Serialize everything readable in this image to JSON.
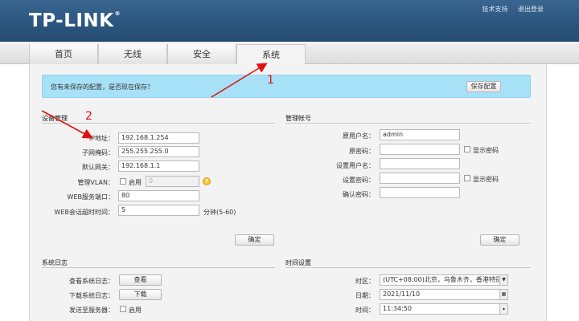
{
  "header": {
    "logo": "TP-LINK",
    "reg": "®",
    "links": [
      "技术支持",
      "退出登录"
    ]
  },
  "tabs": [
    "首页",
    "无线",
    "安全",
    "系统"
  ],
  "active_tab": "系统",
  "notice": {
    "text": "您有未保存的配置，是否现在保存？",
    "save_label": "保存配置"
  },
  "annotations": [
    "1",
    "2"
  ],
  "device_mgmt": {
    "title": "设备管理",
    "ip_label": "IP地址：",
    "ip_value": "192.168.1.254",
    "mask_label": "子网掩码：",
    "mask_value": "255.255.255.0",
    "gateway_label": "默认网关：",
    "gateway_value": "192.168.1.1",
    "vlan_label": "管理VLAN：",
    "vlan_enable": "启用",
    "vlan_value": "0",
    "web_port_label": "WEB服务端口：",
    "web_port_value": "80",
    "timeout_label": "WEB会话超时时间：",
    "timeout_value": "5",
    "timeout_hint": "分钟(5-60)",
    "ok_label": "确定"
  },
  "account": {
    "title": "管理帐号",
    "orig_user_label": "原用户名：",
    "orig_user_value": "admin",
    "orig_pwd_label": "原密码：",
    "show_pwd": "显示密码",
    "new_user_label": "设置用户名：",
    "new_pwd_label": "设置密码：",
    "confirm_pwd_label": "确认密码：",
    "ok_label": "确定"
  },
  "syslog": {
    "title": "系统日志",
    "view_label": "查看系统日志：",
    "view_btn": "查看",
    "download_label": "下载系统日志：",
    "download_btn": "下载",
    "send_label": "发送至服务器：",
    "send_enable": "启用"
  },
  "time": {
    "title": "时间设置",
    "zone_label": "时区：",
    "zone_value": "(UTC+08:00)北京，乌鲁木齐，香港特别",
    "date_label": "日期：",
    "date_value": "2021/11/10",
    "time_label": "时间：",
    "time_value": "11:34:50"
  },
  "colors": {
    "header": "#2b557e",
    "notice": "#a7e1f7",
    "annotation": "#e01010"
  }
}
